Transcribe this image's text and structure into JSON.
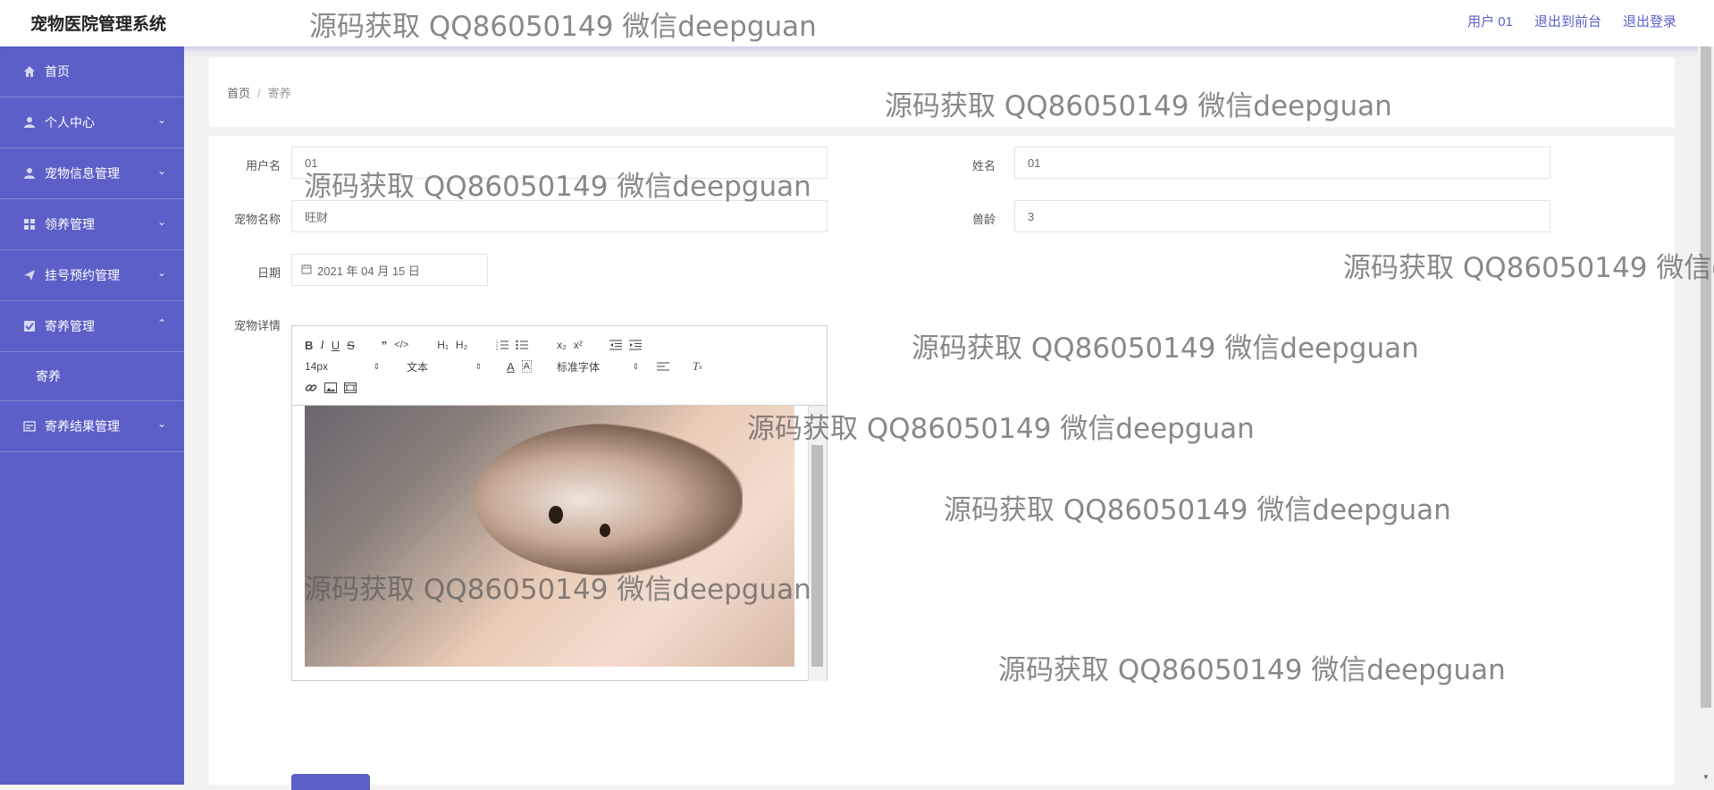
{
  "app": {
    "title": "宠物医院管理系统"
  },
  "top_links": {
    "user": "用户 01",
    "front": "退出到前台",
    "logout": "退出登录"
  },
  "sidebar": {
    "items": [
      {
        "label": "首页",
        "icon": "home-icon"
      },
      {
        "label": "个人中心",
        "icon": "user-icon"
      },
      {
        "label": "宠物信息管理",
        "icon": "user-icon"
      },
      {
        "label": "领养管理",
        "icon": "grid-icon"
      },
      {
        "label": "挂号预约管理",
        "icon": "send-icon"
      },
      {
        "label": "寄养管理",
        "icon": "check-square-icon"
      },
      {
        "label": "寄养结果管理",
        "icon": "form-icon"
      }
    ],
    "sub_item": "寄养"
  },
  "breadcrumb": {
    "home": "首页",
    "sep": "/",
    "current": "寄养"
  },
  "form": {
    "username_label": "用户名",
    "username_value": "01",
    "name_label": "姓名",
    "name_value": "01",
    "pet_name_label": "宠物名称",
    "pet_name_value": "旺财",
    "pet_age_label": "兽龄",
    "pet_age_value": "3",
    "date_label": "日期",
    "date_value": "2021 年 04 月 15 日",
    "detail_label": "宠物详情"
  },
  "editor": {
    "font_size": "14px",
    "block_type": "文本",
    "font_family": "标准字体"
  },
  "watermark": "源码获取 QQ86050149 微信deepguan",
  "colors": {
    "accent": "#5b5fc7"
  }
}
